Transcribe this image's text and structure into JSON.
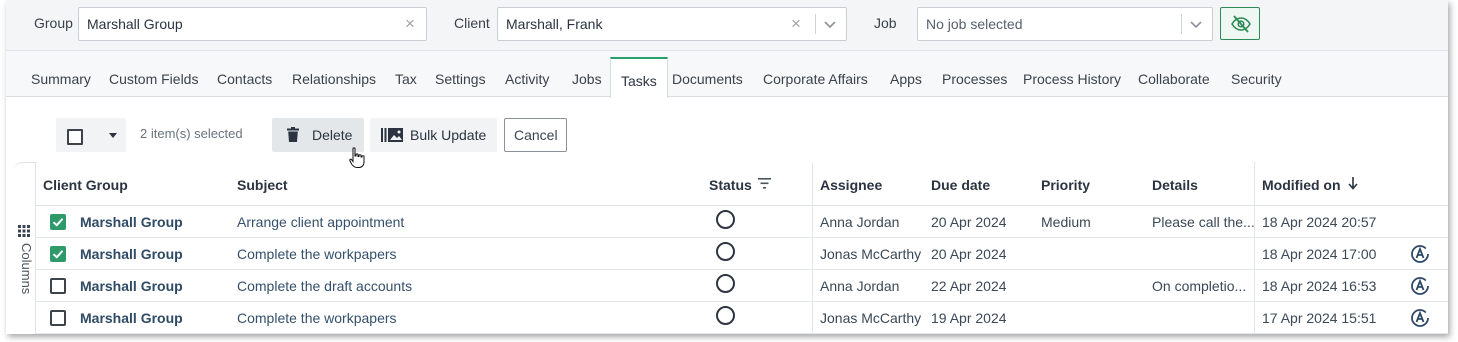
{
  "filters": {
    "group_label": "Group",
    "group_value": "Marshall Group",
    "client_label": "Client",
    "client_value": "Marshall, Frank",
    "job_label": "Job",
    "job_placeholder": "No job selected",
    "visibility_icon": "eye-off-icon"
  },
  "tabs": [
    {
      "label": "Summary"
    },
    {
      "label": "Custom Fields"
    },
    {
      "label": "Contacts"
    },
    {
      "label": "Relationships"
    },
    {
      "label": "Tax"
    },
    {
      "label": "Settings"
    },
    {
      "label": "Activity"
    },
    {
      "label": "Jobs"
    },
    {
      "label": "Tasks",
      "active": true
    },
    {
      "label": "Documents"
    },
    {
      "label": "Corporate Affairs"
    },
    {
      "label": "Apps"
    },
    {
      "label": "Processes"
    },
    {
      "label": "Process History"
    },
    {
      "label": "Collaborate"
    },
    {
      "label": "Security"
    }
  ],
  "actions": {
    "selected_count": "2 item(s) selected",
    "delete_label": "Delete",
    "bulk_update_label": "Bulk Update",
    "cancel_label": "Cancel"
  },
  "grid": {
    "columns_toggle": "Columns",
    "headers": {
      "client_group": "Client Group",
      "subject": "Subject",
      "status": "Status",
      "assignee": "Assignee",
      "due_date": "Due date",
      "priority": "Priority",
      "details": "Details",
      "modified_on": "Modified on"
    },
    "sort": "descending",
    "rows": [
      {
        "checked": true,
        "client_group": "Marshall Group",
        "subject": "Arrange client appointment",
        "status": "not started",
        "assignee": "Anna Jordan",
        "due_date": "20 Apr 2024",
        "priority": "Medium",
        "details": "Please call the...",
        "modified_on": "18 Apr 2024 20:57",
        "automated": false
      },
      {
        "checked": true,
        "client_group": "Marshall Group",
        "subject": "Complete the workpapers",
        "status": "not started",
        "assignee": "Jonas McCarthy",
        "due_date": "20 Apr 2024",
        "priority": "",
        "details": "",
        "modified_on": "18 Apr 2024 17:00",
        "automated": true
      },
      {
        "checked": false,
        "client_group": "Marshall Group",
        "subject": "Complete the draft accounts",
        "status": "not started",
        "assignee": "Anna Jordan",
        "due_date": "22 Apr 2024",
        "priority": "",
        "details": "On completio...",
        "modified_on": "18 Apr 2024 16:53",
        "automated": true
      },
      {
        "checked": false,
        "client_group": "Marshall Group",
        "subject": "Complete the workpapers",
        "status": "not started",
        "assignee": "Jonas McCarthy",
        "due_date": "19 Apr 2024",
        "priority": "",
        "details": "",
        "modified_on": "17 Apr 2024 15:51",
        "automated": true
      }
    ]
  },
  "colors": {
    "accent": "#25a06a",
    "checkbox_on": "#2e9a6a",
    "link": "#2e4a66"
  }
}
